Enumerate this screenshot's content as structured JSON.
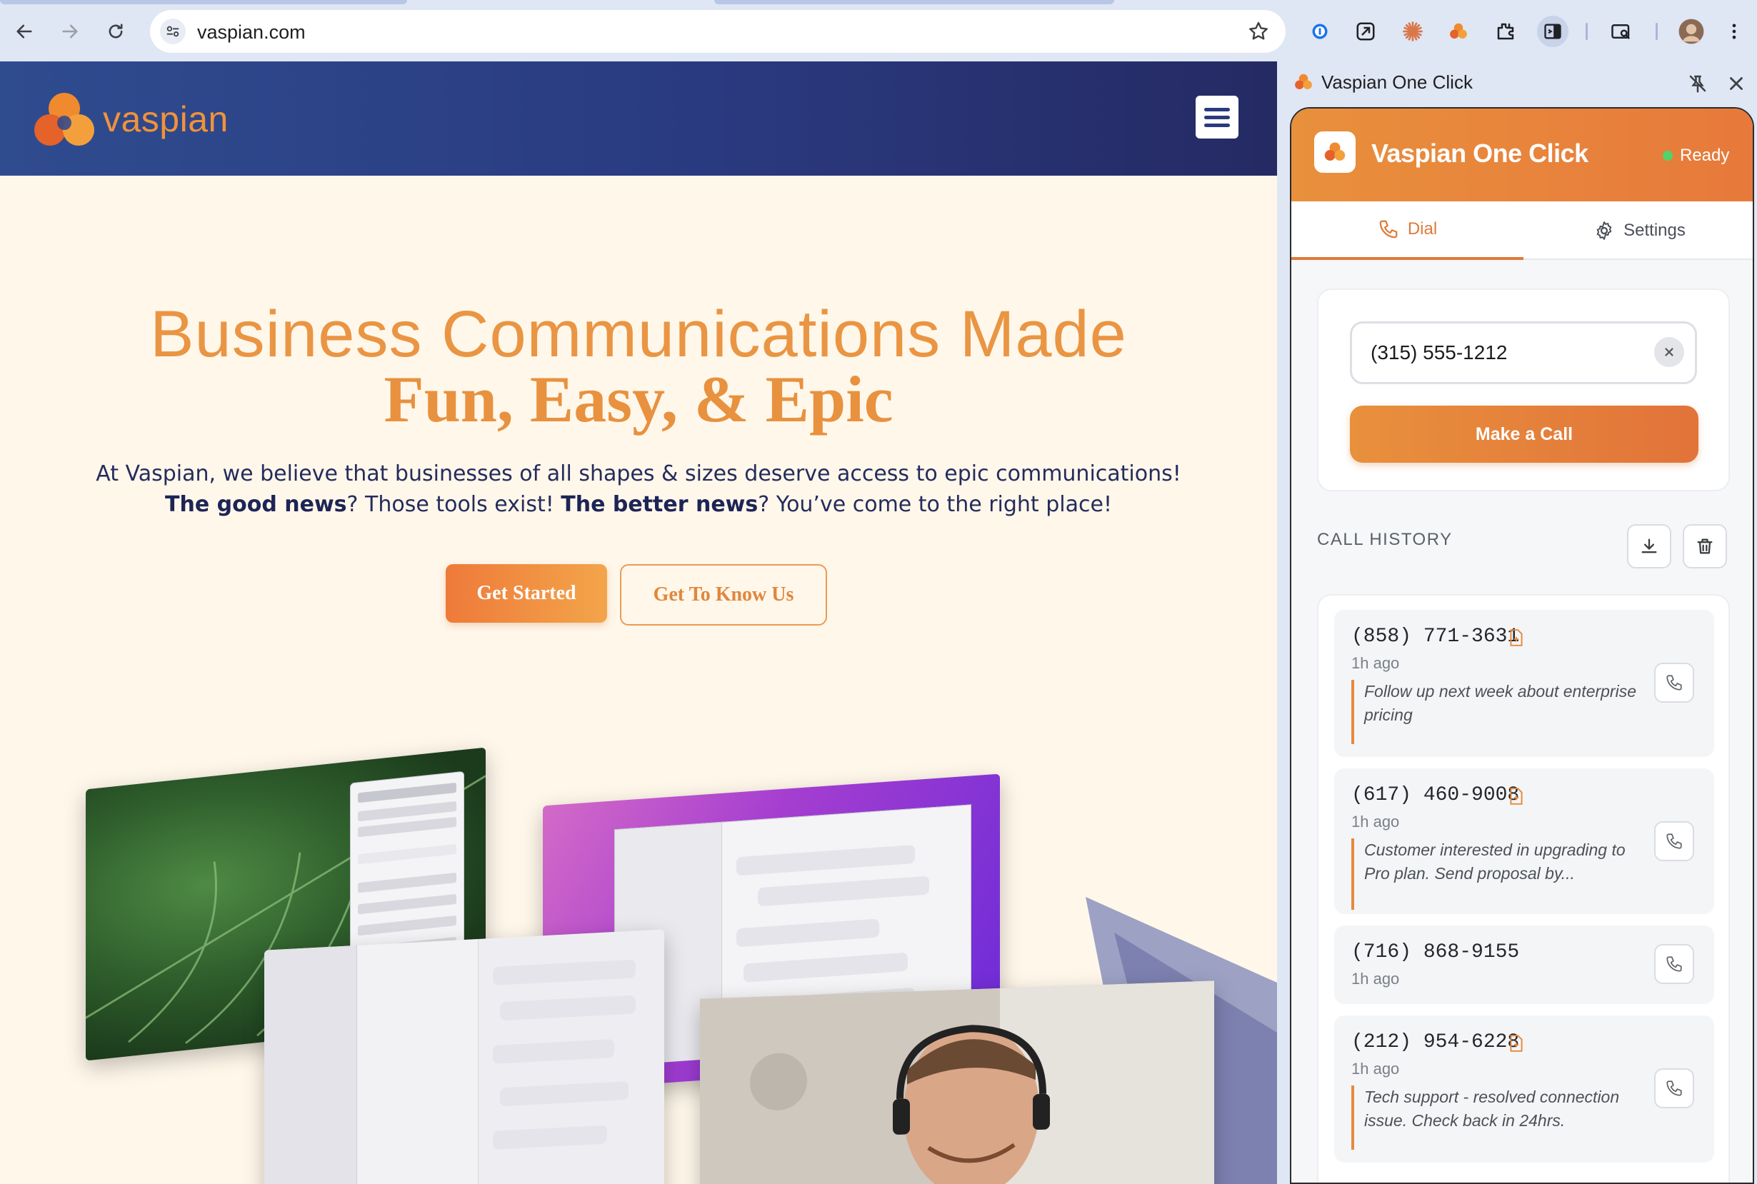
{
  "browser": {
    "url": "vaspian.com",
    "icons": [
      "back-arrow-icon",
      "forward-arrow-icon",
      "reload-icon",
      "site-settings-icon",
      "bookmark-star-icon",
      "password-manager-icon",
      "compose-icon",
      "claude-icon",
      "vaspian-extension-icon",
      "extensions-puzzle-icon",
      "side-panel-icon",
      "tab-search-icon",
      "profile-avatar",
      "menu-kebab-icon"
    ]
  },
  "site": {
    "logo_text": "vaspian",
    "hero": {
      "line1": "Business Communications Made",
      "line2": "Fun, Easy, & Epic",
      "para_1": "At Vaspian, we believe that businesses of all shapes & sizes deserve access to epic communications! ",
      "para_bold_1": "The good news",
      "para_2": "? Those tools exist! ",
      "para_bold_2": "The better news",
      "para_3": "? You’ve come to the right place!"
    },
    "buttons": {
      "primary": "Get Started",
      "secondary": "Get To Know Us"
    }
  },
  "side_panel": {
    "title": "Vaspian One Click",
    "extension": {
      "title": "Vaspian One Click",
      "status": "Ready",
      "tabs": {
        "dial": "Dial",
        "settings": "Settings"
      },
      "phone_input_value": "(315) 555-1212",
      "call_button": "Make a Call",
      "history_label": "CALL HISTORY",
      "history": [
        {
          "number": "(858) 771-3631",
          "time": "1h ago",
          "note": "Follow up next week about enterprise pricing",
          "has_note": true
        },
        {
          "number": "(617) 460-9008",
          "time": "1h ago",
          "note": "Customer interested in upgrading to Pro plan. Send proposal by...",
          "has_note": true
        },
        {
          "number": "(716) 868-9155",
          "time": "1h ago",
          "note": "",
          "has_note": false
        },
        {
          "number": "(212) 954-6228",
          "time": "1h ago",
          "note": "Tech support - resolved connection issue. Check back in 24hrs.",
          "has_note": true
        }
      ]
    }
  },
  "colors": {
    "accent_orange": "#e8903c",
    "header_navy": "#2a3a80",
    "ready_green": "#4fd36a",
    "page_cream": "#fff7ea"
  }
}
